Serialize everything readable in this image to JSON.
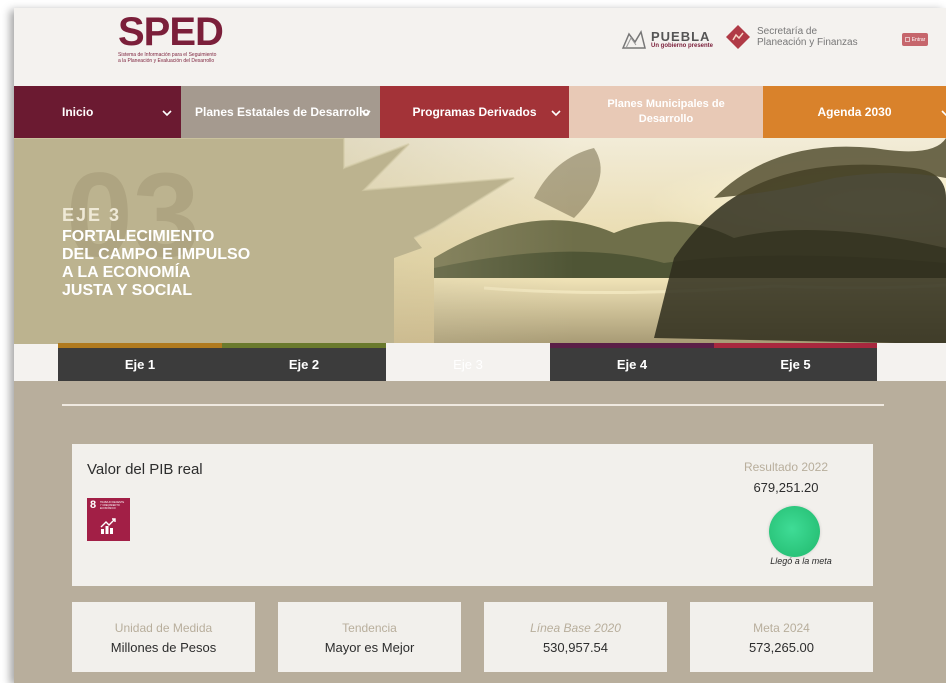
{
  "header": {
    "logo_title": "SPED",
    "logo_subtitle_1": "Sistema de Información para el Seguimiento",
    "logo_subtitle_2": "a la Planeación y Evaluación del Desarrollo",
    "puebla_name": "PUEBLA",
    "puebla_tagline": "Un gobierno presente",
    "secretaria_line1": "Secretaría de",
    "secretaria_line2": "Planeación y Finanzas",
    "login_label": "Entrar"
  },
  "nav": {
    "items": [
      {
        "label": "Inicio"
      },
      {
        "label": "Planes Estatales de Desarrollo"
      },
      {
        "label": "Programas Derivados"
      },
      {
        "label": "Planes Municipales de Desarrollo"
      },
      {
        "label": "Agenda 2030"
      }
    ]
  },
  "banner": {
    "eje_label": "EJE 3",
    "title_lines": [
      "FORTALECIMIENTO",
      "DEL CAMPO E IMPULSO",
      "A LA ECONOMÍA",
      "JUSTA Y SOCIAL"
    ],
    "colors": {
      "panel": "#b9b08c",
      "accent": "#d4cca8"
    }
  },
  "tabs": [
    {
      "label": "Eje 1",
      "color": "#b07a1f"
    },
    {
      "label": "Eje 2",
      "color": "#6a7a2d"
    },
    {
      "label": "Eje 3",
      "color": "#f4f2ef",
      "active": true
    },
    {
      "label": "Eje 4",
      "color": "#5a1f47"
    },
    {
      "label": "Eje 5",
      "color": "#a8283e"
    }
  ],
  "indicator": {
    "name": "Valor del PIB real",
    "ods": {
      "number": "8",
      "text": "TRABAJO DECENTE Y CRECIMIENTO ECONÓMICO",
      "icon": "growth-chart-icon",
      "color": "#a21f46"
    },
    "result_label": "Resultado 2022",
    "result_value": "679,251.20",
    "status": "Llegó a la meta",
    "status_color": "#2fcc80"
  },
  "stats": [
    {
      "label": "Unidad de Medida",
      "value": "Millones de Pesos"
    },
    {
      "label": "Tendencia",
      "value": "Mayor es Mejor"
    },
    {
      "label": "Línea Base 2020",
      "value": "530,957.54"
    },
    {
      "label": "Meta 2024",
      "value": "573,265.00"
    }
  ]
}
